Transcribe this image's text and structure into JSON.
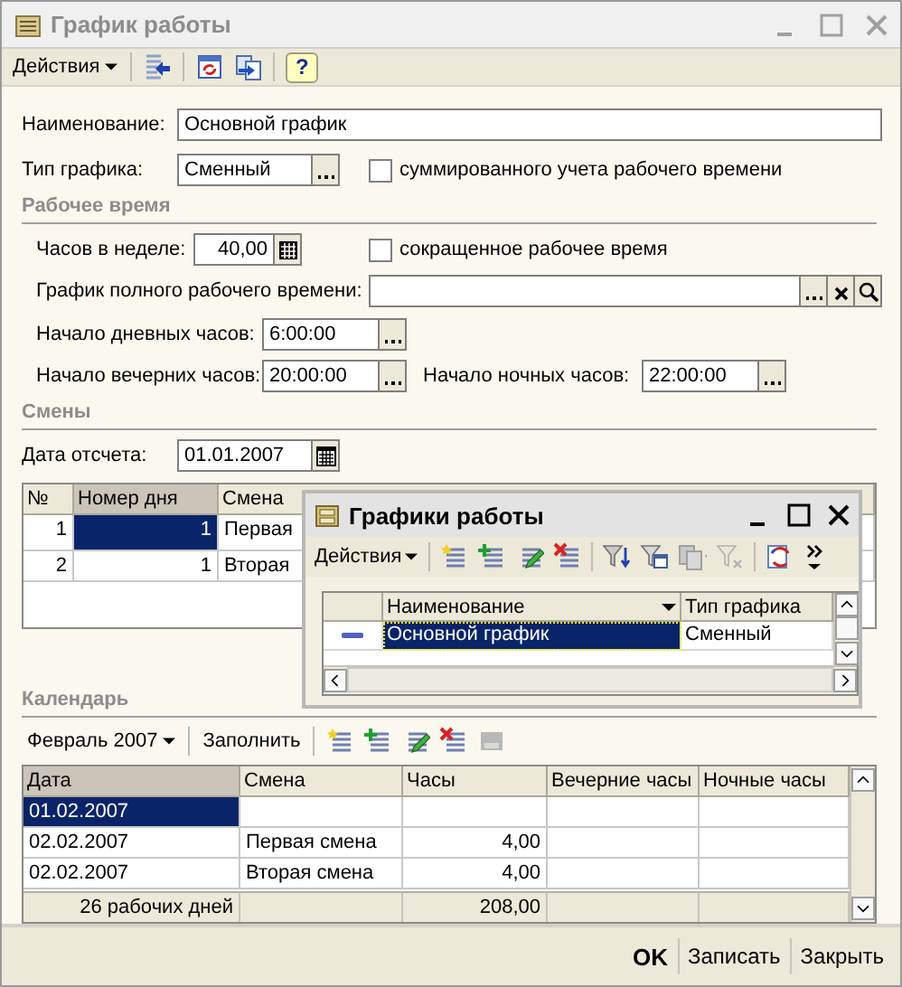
{
  "window": {
    "title": "График работы"
  },
  "toolbar": {
    "actions_menu": "Действия",
    "help_button": "?"
  },
  "form": {
    "name": {
      "label": "Наименование:",
      "value": "Основной график"
    },
    "schedule_type": {
      "label": "Тип графика:",
      "value": "Сменный"
    },
    "summarized_accounting": {
      "label": "суммированного учета рабочего времени",
      "checked": false
    }
  },
  "working_time": {
    "title": "Рабочее время",
    "hours_per_week": {
      "label": "Часов в неделе:",
      "value": "40,00"
    },
    "reduced_time": {
      "label": "сокращенное рабочее время",
      "checked": false
    },
    "full_time_schedule": {
      "label": "График полного рабочего времени:"
    },
    "day_start": {
      "label": "Начало дневных часов:",
      "value": "6:00:00"
    },
    "evening_start": {
      "label": "Начало вечерних часов:",
      "value": "20:00:00"
    },
    "night_start": {
      "label": "Начало ночных часов:",
      "value": "22:00:00"
    }
  },
  "shifts": {
    "title": "Смены",
    "reference_date": {
      "label": "Дата отсчета:",
      "value": "01.01.2007"
    },
    "columns": [
      {
        "label": "№",
        "active": false
      },
      {
        "label": "Номер дня",
        "active": true
      },
      {
        "label": "Смена",
        "active": false
      }
    ],
    "rows": [
      {
        "number": "1",
        "day": "1",
        "shift": "Первая",
        "selected": true
      },
      {
        "number": "2",
        "day": "1",
        "shift": "Вторая",
        "selected": false
      }
    ]
  },
  "calendar": {
    "title": "Календарь",
    "month": "Февраль 2007",
    "fill_button": "Заполнить",
    "columns": [
      {
        "label": "Дата",
        "active": true
      },
      {
        "label": "Смена",
        "active": false
      },
      {
        "label": "Часы",
        "active": false
      },
      {
        "label": "Вечерние часы",
        "active": false
      },
      {
        "label": "Ночные часы",
        "active": false
      }
    ],
    "rows": [
      {
        "date": "01.02.2007",
        "selected": true
      },
      {
        "date": "02.02.2007",
        "shift": "Первая смена",
        "hours": "4,00",
        "selected": false
      },
      {
        "date": "02.02.2007",
        "shift": "Вторая смена",
        "hours": "4,00",
        "selected": false
      }
    ],
    "footer": {
      "days": "26 рабочих дней",
      "hours": "208,00"
    }
  },
  "popup": {
    "title": "Графики работы",
    "actions_menu": "Действия",
    "columns": [
      {
        "label": "Наименование",
        "sorted": true
      },
      {
        "label": "Тип графика",
        "sorted": false
      }
    ],
    "rows": [
      {
        "name": "Основной график",
        "type": "Сменный",
        "selected": true
      }
    ]
  },
  "buttons": [
    {
      "label": "OK",
      "default": true
    },
    {
      "label": "Записать",
      "default": false
    },
    {
      "label": "Закрыть",
      "default": false
    }
  ]
}
